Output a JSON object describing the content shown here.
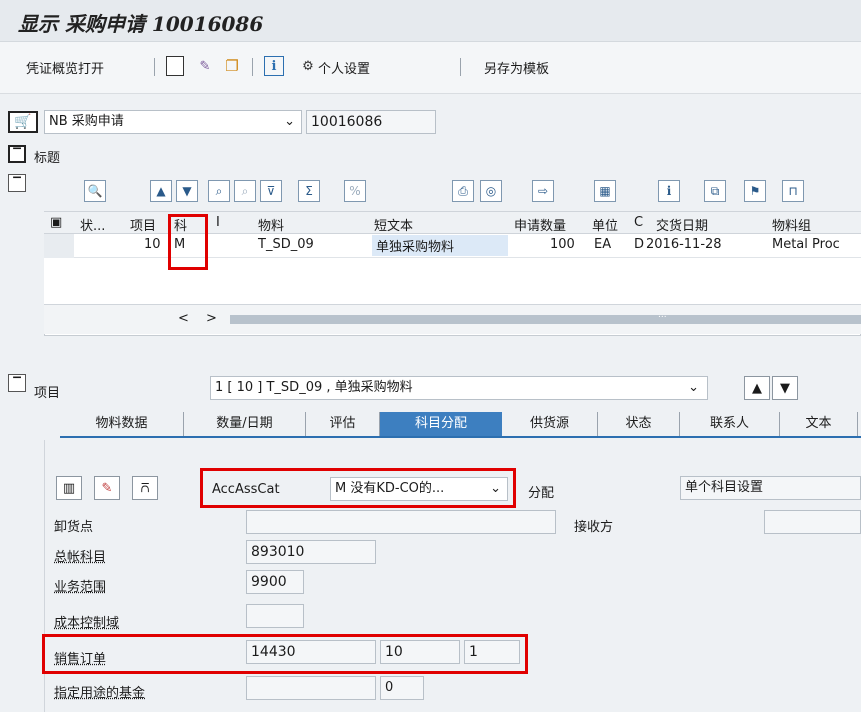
{
  "title": "显示 采购申请 10016086",
  "toolbar": {
    "overview_label": "凭证概览打开",
    "personal_settings_label": "个人设置",
    "save_as_template_label": "另存为模板"
  },
  "header": {
    "doc_type": "NB 采购申请",
    "doc_number": "10016086",
    "heading_label": "标题"
  },
  "grid": {
    "columns": [
      "状...",
      "项目",
      "科",
      "I",
      "物料",
      "短文本",
      "申请数量",
      "单位",
      "C",
      "交货日期",
      "物料组"
    ],
    "rows": [
      {
        "status": "",
        "item": "10",
        "acct": "M",
        "i": "",
        "material": "T_SD_09",
        "short_text": "单独采购物料",
        "qty": "100",
        "unit": "EA",
        "c": "D",
        "delivery_date": "2016-11-28",
        "material_group": "Metal Proc"
      }
    ],
    "scroll_left": "<",
    "scroll_right": ">",
    "scroll_dots": "..."
  },
  "item_section": {
    "label": "项目",
    "selected_item": "1 [ 10 ] T_SD_09 , 单独采购物料"
  },
  "tabs": [
    "物料数据",
    "数量/日期",
    "评估",
    "科目分配",
    "供货源",
    "状态",
    "联系人",
    "文本"
  ],
  "active_tab": "科目分配",
  "account_assignment": {
    "acc_ass_cat_label": "AccAssCat",
    "acc_ass_cat_value": "M 没有KD-CO的...",
    "distribution_label": "分配",
    "distribution_value": "单个科目设置",
    "unloading_point_label": "卸货点",
    "unloading_point_value": "",
    "recipient_label": "接收方",
    "recipient_value": "",
    "gl_account_label": "总帐科目",
    "gl_account_value": "893010",
    "business_area_label": "业务范围",
    "business_area_value": "9900",
    "co_area_label": "成本控制域",
    "co_area_value": "",
    "sales_order_label": "销售订单",
    "sales_order_value": "14430",
    "sales_order_item": "10",
    "sales_order_schedule": "1",
    "earmarked_funds_label": "指定用途的基金",
    "earmarked_funds_value": "",
    "earmarked_funds_item": "0"
  },
  "colors": {
    "highlight_red": "#e00000",
    "active_tab_blue": "#3d7fc0",
    "selected_cell": "#dce9f7"
  }
}
